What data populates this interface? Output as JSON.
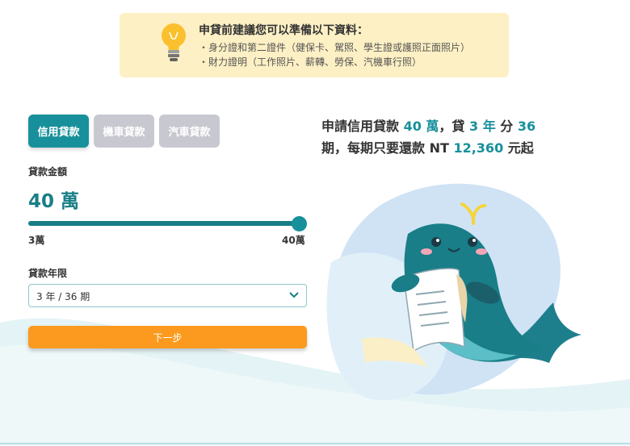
{
  "notice": {
    "title": "申貸前建議您可以準備以下資料：",
    "items": [
      "・身分證和第二證件（健保卡、駕照、學生證或護照正面照片）",
      "・財力證明（工作照片、薪轉、勞保、汽機車行照）"
    ]
  },
  "tabs": [
    {
      "label": "信用貸款",
      "active": true
    },
    {
      "label": "機車貸款",
      "active": false
    },
    {
      "label": "汽車貸款",
      "active": false
    }
  ],
  "amount": {
    "label": "貸款金額",
    "value": "40 萬",
    "min_label": "3萬",
    "max_label": "40萬",
    "slider_fraction": 1.0
  },
  "term": {
    "label": "貸款年限",
    "selected": "3 年 / 36 期"
  },
  "next_button": "下一步",
  "headline": {
    "t1": "申請信用貸款 ",
    "amount": "40 萬",
    "t2": "，貸 ",
    "years": "3 年",
    "t3": " 分 ",
    "periods": "36",
    "t4": "期，每期只要還款 NT ",
    "payment": "12,360",
    "t5": " 元起"
  },
  "colors": {
    "accent": "#18909b",
    "orange": "#fb9a1f",
    "notice_bg": "#fdf0c4",
    "inactive_tab": "#c8c9d0"
  }
}
